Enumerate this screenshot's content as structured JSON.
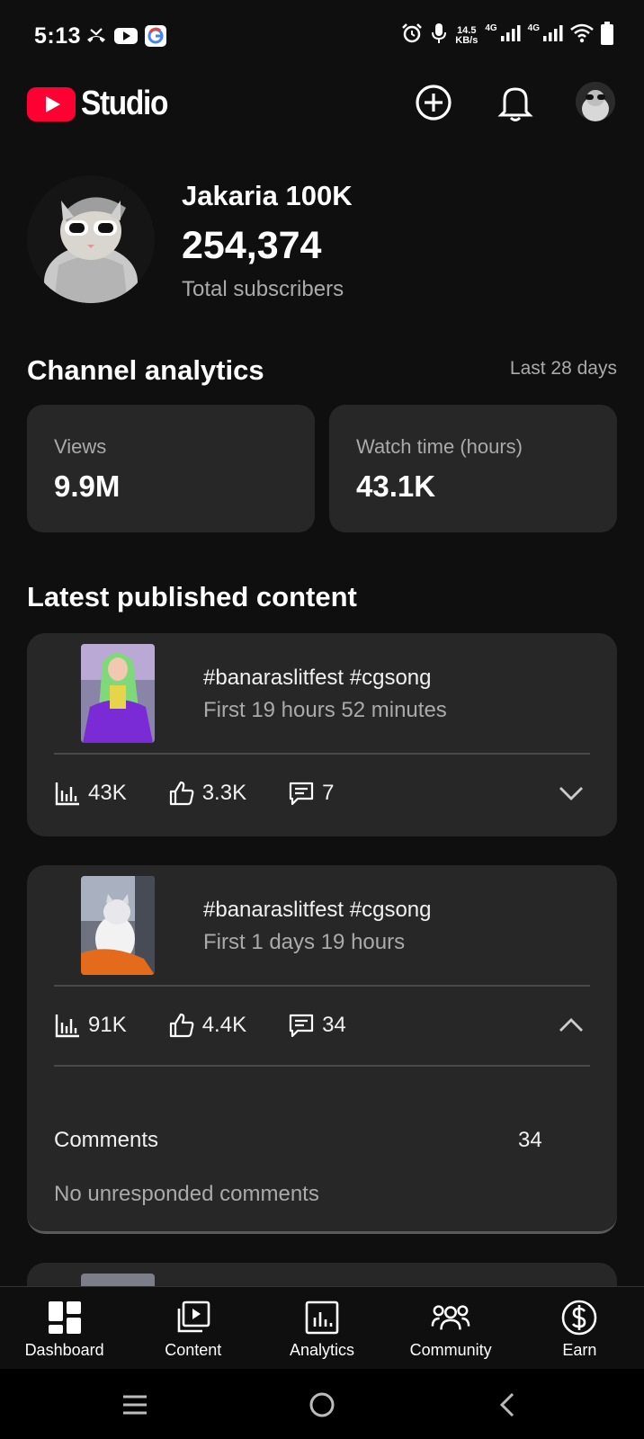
{
  "status_bar": {
    "time": "5:13",
    "net_speed_value": "14.5",
    "net_speed_unit": "KB/s",
    "network_tag_1": "4G",
    "network_tag_2": "4G",
    "left_icons": [
      "missed-call-icon",
      "youtube-icon",
      "google-icon"
    ],
    "right_icons": [
      "alarm-icon",
      "mic-icon",
      "signal-icon",
      "signal-icon",
      "wifi-icon",
      "battery-icon"
    ]
  },
  "header": {
    "app_name": "Studio",
    "actions": [
      "create-icon",
      "notifications-icon",
      "account-avatar"
    ]
  },
  "channel": {
    "name": "Jakaria 100K",
    "subscriber_count": "254,374",
    "subscriber_label": "Total subscribers"
  },
  "analytics": {
    "title": "Channel analytics",
    "period": "Last 28 days",
    "stats": [
      {
        "label": "Views",
        "value": "9.9M"
      },
      {
        "label": "Watch time (hours)",
        "value": "43.1K"
      }
    ]
  },
  "latest": {
    "title": "Latest published content",
    "items": [
      {
        "title": "#banaraslitfest #cgsong",
        "subtitle": "First 19 hours 52 minutes",
        "views": "43K",
        "likes": "3.3K",
        "comments": "7",
        "expanded": false
      },
      {
        "title": "#banaraslitfest #cgsong",
        "subtitle": "First 1 days 19 hours",
        "views": "91K",
        "likes": "4.4K",
        "comments": "34",
        "expanded": true,
        "details": {
          "comments_label": "Comments",
          "comments_count": "34",
          "unresponded_text": "No unresponded comments"
        }
      }
    ]
  },
  "bottom_nav": [
    {
      "label": "Dashboard",
      "icon": "dashboard-icon",
      "selected": true
    },
    {
      "label": "Content",
      "icon": "content-icon",
      "selected": false
    },
    {
      "label": "Analytics",
      "icon": "analytics-icon",
      "selected": false
    },
    {
      "label": "Community",
      "icon": "community-icon",
      "selected": false
    },
    {
      "label": "Earn",
      "icon": "earn-icon",
      "selected": false
    }
  ],
  "colors": {
    "background": "#0f0f0f",
    "card": "#272727",
    "brand_red": "#ff0033",
    "secondary_text": "#aaaaaa"
  }
}
